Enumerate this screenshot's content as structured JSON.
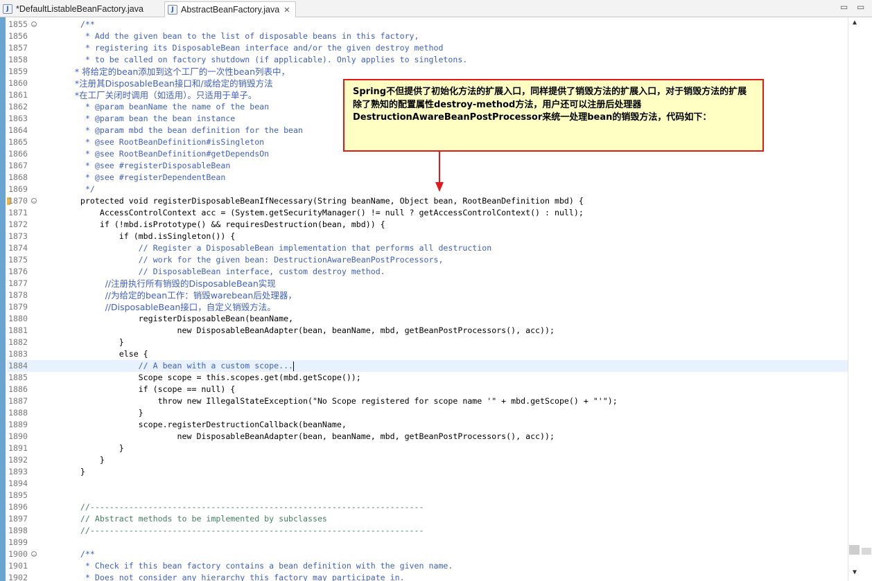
{
  "tabs": [
    {
      "label": "*DefaultListableBeanFactory.java",
      "icon": "java-file-icon"
    },
    {
      "label": "AbstractBeanFactory.java",
      "icon": "java-file-icon",
      "close": "✕"
    }
  ],
  "window_controls": {
    "minimize": "▭",
    "maximize": "▭"
  },
  "callout": {
    "text": "Spring不但提供了初始化方法的扩展入口，同样提供了销毁方法的扩展入口，对于销毁方法的扩展除了熟知的配置属性destroy-method方法，用户还可以注册后处理器DestructionAwareBeanPostProcessor来统一处理bean的销毁方法，代码如下："
  },
  "code_lines": [
    {
      "n": "1855",
      "t": "    /**",
      "k": "c-comment",
      "fold": "⊖"
    },
    {
      "n": "1856",
      "t": "     * Add the given bean to the list of disposable beans in this factory,",
      "k": "c-comment"
    },
    {
      "n": "1857",
      "t": "     * registering its DisposableBean interface and/or the given destroy method",
      "k": "c-comment"
    },
    {
      "n": "1858",
      "t": "     * to be called on factory shutdown (if applicable). Only applies to singletons.",
      "k": "c-comment"
    },
    {
      "n": "1859",
      "t": "     * 将给定的bean添加到这个工厂的一次性bean列表中，",
      "k": "c-cn"
    },
    {
      "n": "1860",
      "t": "     *注册其DisposableBean接口和/或给定的销毁方法",
      "k": "c-cn"
    },
    {
      "n": "1861",
      "t": "     *在工厂关闭时调用（如适用）。只适用于单子。",
      "k": "c-cn"
    },
    {
      "n": "1862",
      "t": "     * @param beanName the name of the bean",
      "k": "c-comment"
    },
    {
      "n": "1863",
      "t": "     * @param bean the bean instance",
      "k": "c-comment"
    },
    {
      "n": "1864",
      "t": "     * @param mbd the bean definition for the bean",
      "k": "c-comment"
    },
    {
      "n": "1865",
      "t": "     * @see RootBeanDefinition#isSingleton",
      "k": "c-comment"
    },
    {
      "n": "1866",
      "t": "     * @see RootBeanDefinition#getDependsOn",
      "k": "c-comment"
    },
    {
      "n": "1867",
      "t": "     * @see #registerDisposableBean",
      "k": "c-comment"
    },
    {
      "n": "1868",
      "t": "     * @see #registerDependentBean",
      "k": "c-comment"
    },
    {
      "n": "1869",
      "t": "     */",
      "k": "c-comment"
    },
    {
      "n": "1870",
      "t": "    protected void registerDisposableBeanIfNecessary(String beanName, Object bean, RootBeanDefinition mbd) {",
      "k": "c-code",
      "fold": "⊖",
      "warn": true
    },
    {
      "n": "1871",
      "t": "        AccessControlContext acc = (System.getSecurityManager() != null ? getAccessControlContext() : null);",
      "k": "c-code"
    },
    {
      "n": "1872",
      "t": "        if (!mbd.isPrototype() && requiresDestruction(bean, mbd)) {",
      "k": "c-code"
    },
    {
      "n": "1873",
      "t": "            if (mbd.isSingleton()) {",
      "k": "c-code"
    },
    {
      "n": "1874",
      "t": "                // Register a DisposableBean implementation that performs all destruction",
      "k": "c-comment"
    },
    {
      "n": "1875",
      "t": "                // work for the given bean: DestructionAwareBeanPostProcessors,",
      "k": "c-comment"
    },
    {
      "n": "1876",
      "t": "                // DisposableBean interface, custom destroy method.",
      "k": "c-comment"
    },
    {
      "n": "1877",
      "t": "                //注册执行所有销毁的DisposableBean实现",
      "k": "c-cn"
    },
    {
      "n": "1878",
      "t": "                //为给定的bean工作：销毁warebean后处理器，",
      "k": "c-cn"
    },
    {
      "n": "1879",
      "t": "                //DisposableBean接口，自定义销毁方法。",
      "k": "c-cn"
    },
    {
      "n": "1880",
      "t": "                registerDisposableBean(beanName,",
      "k": "c-code"
    },
    {
      "n": "1881",
      "t": "                        new DisposableBeanAdapter(bean, beanName, mbd, getBeanPostProcessors(), acc));",
      "k": "c-code"
    },
    {
      "n": "1882",
      "t": "            }",
      "k": "c-code"
    },
    {
      "n": "1883",
      "t": "            else {",
      "k": "c-code"
    },
    {
      "n": "1884",
      "t": "                // A bean with a custom scope...",
      "k": "c-comment",
      "current": true
    },
    {
      "n": "1885",
      "t": "                Scope scope = this.scopes.get(mbd.getScope());",
      "k": "c-code"
    },
    {
      "n": "1886",
      "t": "                if (scope == null) {",
      "k": "c-code"
    },
    {
      "n": "1887",
      "t": "                    throw new IllegalStateException(\"No Scope registered for scope name '\" + mbd.getScope() + \"'\");",
      "k": "c-code"
    },
    {
      "n": "1888",
      "t": "                }",
      "k": "c-code"
    },
    {
      "n": "1889",
      "t": "                scope.registerDestructionCallback(beanName,",
      "k": "c-code"
    },
    {
      "n": "1890",
      "t": "                        new DisposableBeanAdapter(bean, beanName, mbd, getBeanPostProcessors(), acc));",
      "k": "c-code"
    },
    {
      "n": "1891",
      "t": "            }",
      "k": "c-code"
    },
    {
      "n": "1892",
      "t": "        }",
      "k": "c-code"
    },
    {
      "n": "1893",
      "t": "    }",
      "k": "c-code"
    },
    {
      "n": "1894",
      "t": "",
      "k": "c-code"
    },
    {
      "n": "1895",
      "t": "",
      "k": "c-code"
    },
    {
      "n": "1896",
      "t": "    //---------------------------------------------------------------------",
      "k": "c-line"
    },
    {
      "n": "1897",
      "t": "    // Abstract methods to be implemented by subclasses",
      "k": "c-line"
    },
    {
      "n": "1898",
      "t": "    //---------------------------------------------------------------------",
      "k": "c-line"
    },
    {
      "n": "1899",
      "t": "",
      "k": "c-code"
    },
    {
      "n": "1900",
      "t": "    /**",
      "k": "c-comment",
      "fold": "⊖"
    },
    {
      "n": "1901",
      "t": "     * Check if this bean factory contains a bean definition with the given name.",
      "k": "c-comment"
    },
    {
      "n": "1902",
      "t": "     * Does not consider any hierarchy this factory may participate in.",
      "k": "c-comment"
    }
  ],
  "scrollbar": {
    "up": "▲",
    "down": "▼"
  }
}
